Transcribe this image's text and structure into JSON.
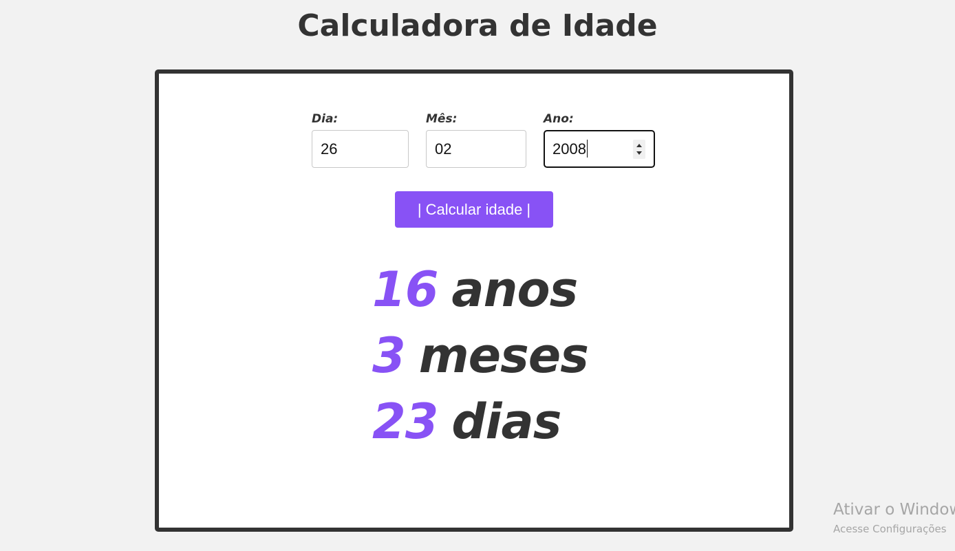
{
  "page": {
    "title": "Calculadora de Idade"
  },
  "form": {
    "day": {
      "label": "Dia:",
      "value": "26"
    },
    "month": {
      "label": "Mês:",
      "value": "02"
    },
    "year": {
      "label": "Ano:",
      "value": "2008"
    },
    "submit_label": "| Calcular idade |"
  },
  "result": {
    "years": {
      "value": "16",
      "unit": "anos"
    },
    "months": {
      "value": "3",
      "unit": "meses"
    },
    "days": {
      "value": "23",
      "unit": "dias"
    }
  },
  "watermark": {
    "title": "Ativar o Windows",
    "subtitle": "Acesse Configurações"
  },
  "colors": {
    "accent": "#8852f5",
    "text": "#333333",
    "background": "#f2f2f2"
  }
}
